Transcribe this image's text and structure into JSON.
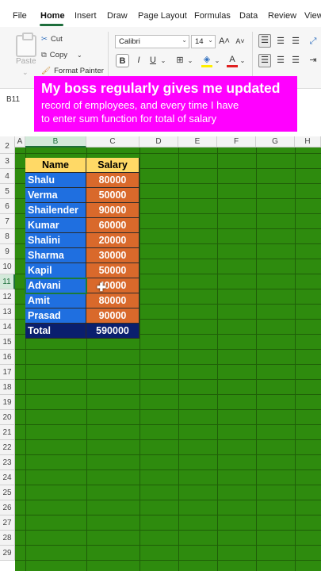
{
  "ribbon_tabs": [
    "File",
    "Home",
    "Insert",
    "Draw",
    "Page Layout",
    "Formulas",
    "Data",
    "Review",
    "View"
  ],
  "active_tab": "Home",
  "clipboard": {
    "paste_label": "Paste",
    "cut_label": "Cut",
    "copy_label": "Copy",
    "format_painter_label": "Format Painter"
  },
  "font": {
    "name": "Calibri",
    "size": "14",
    "bold": "B",
    "italic": "I",
    "underline": "U"
  },
  "name_box": "B11",
  "overlay": {
    "title": "My boss regularly gives me updated",
    "line1": "record of employees, and every time I have",
    "line2": "to enter sum function for total of salary"
  },
  "columns": [
    "A",
    "B",
    "C",
    "D",
    "E",
    "F",
    "G",
    "H"
  ],
  "selected_column": "B",
  "rows": [
    "2",
    "3",
    "4",
    "5",
    "6",
    "7",
    "8",
    "9",
    "10",
    "11",
    "12",
    "13",
    "14",
    "15",
    "16",
    "17",
    "18",
    "19",
    "20",
    "21",
    "22",
    "23",
    "24",
    "25",
    "26",
    "27",
    "28",
    "29"
  ],
  "selected_row": "11",
  "table": {
    "header_name": "Name",
    "header_salary": "Salary",
    "records": [
      {
        "name": "Shalu",
        "salary": "80000"
      },
      {
        "name": "Verma",
        "salary": "50000"
      },
      {
        "name": "Shailender",
        "salary": "90000"
      },
      {
        "name": "Kumar",
        "salary": "60000"
      },
      {
        "name": "Shalini",
        "salary": "20000"
      },
      {
        "name": "Sharma",
        "salary": "30000"
      },
      {
        "name": "Kapil",
        "salary": "50000"
      },
      {
        "name": "Advani",
        "salary": "40000"
      },
      {
        "name": "Amit",
        "salary": "80000"
      },
      {
        "name": "Prasad",
        "salary": "90000"
      }
    ],
    "total_label": "Total",
    "total_value": "590000"
  },
  "colors": {
    "sheet_fill": "#2e8b0e",
    "header_fill": "#ffd966",
    "name_fill": "#1f6fe0",
    "salary_fill": "#d9692b",
    "total_fill": "#0a1f6e",
    "overlay": "#ff00ff",
    "accent": "#1e6e3c"
  }
}
